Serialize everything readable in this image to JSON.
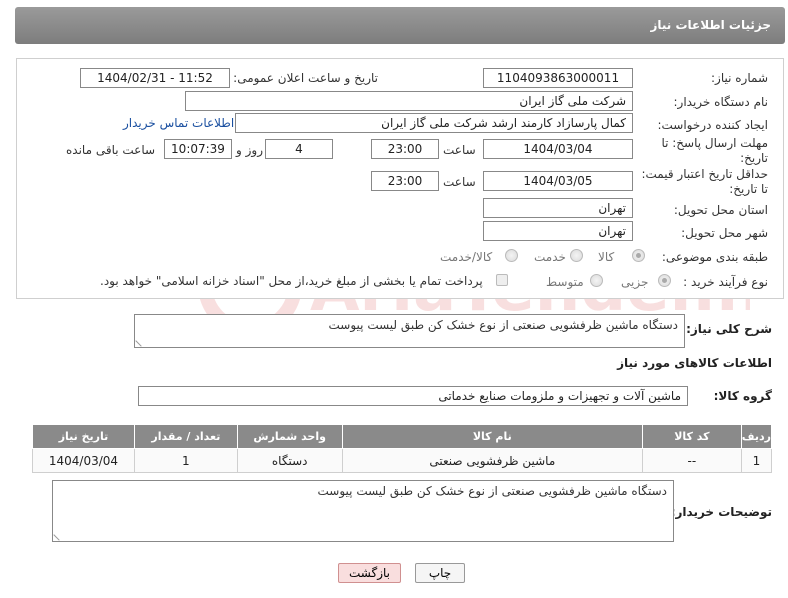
{
  "header": {
    "title": "جزئیات اطلاعات نیاز"
  },
  "form": {
    "need_number_label": "شماره نیاز:",
    "need_number": "1104093863000011",
    "announce_label": "تاریخ و ساعت اعلان عمومی:",
    "announce_value": "1404/02/31 - 11:52",
    "buyer_org_label": "نام دستگاه خریدار:",
    "buyer_org": "شرکت ملی گاز ایران",
    "creator_label": "ایجاد کننده درخواست:",
    "creator": "کمال پارسازاد کارمند ارشد شرکت ملی گاز ایران",
    "contact_link": "اطلاعات تماس خریدار",
    "reply_deadline_label_1": "مهلت ارسال پاسخ: تا",
    "reply_deadline_label_2": "تاریخ:",
    "reply_date": "1404/03/04",
    "time_label": "ساعت",
    "reply_time": "23:00",
    "days_value": "4",
    "days_label": "روز و",
    "remaining_time": "10:07:39",
    "remaining_label": "ساعت باقی مانده",
    "price_validity_label_1": "حداقل تاریخ اعتبار قیمت:",
    "price_validity_label_2": "تا تاریخ:",
    "price_date": "1404/03/05",
    "price_time": "23:00",
    "province_label": "استان محل تحویل:",
    "province": "تهران",
    "city_label": "شهر محل تحویل:",
    "city": "تهران",
    "category_label": "طبقه بندی موضوعی:",
    "category_options": [
      "کالا",
      "خدمت",
      "کالا/خدمت"
    ],
    "process_label": "نوع فرآیند خرید :",
    "process_options": [
      "جزیی",
      "متوسط"
    ],
    "payment_note": "پرداخت تمام یا بخشی از مبلغ خرید،از محل \"اسناد خزانه اسلامی\" خواهد بود."
  },
  "description": {
    "label": "شرح کلی نیاز:",
    "text": "دستگاه ماشین ظرفشویی صنعتی از نوع خشک کن طبق لیست پیوست"
  },
  "goods": {
    "section_title": "اطلاعات کالاهای مورد نیاز",
    "group_label": "گروه کالا:",
    "group_value": "ماشین آلات و تجهیزات و ملزومات صنایع خدماتی",
    "columns": [
      "ردیف",
      "کد کالا",
      "نام کالا",
      "واحد شمارش",
      "تعداد / مقدار",
      "تاریخ نیاز"
    ],
    "rows": [
      [
        "1",
        "--",
        "ماشین ظرفشویی صنعتی",
        "دستگاه",
        "1",
        "1404/03/04"
      ]
    ]
  },
  "buyer_notes": {
    "label": "توضیحات خریدار:",
    "text": "دستگاه ماشین ظرفشویی صنعتی از نوع خشک کن طبق لیست پیوست"
  },
  "buttons": {
    "print": "چاپ",
    "back": "بازگشت"
  },
  "watermark": "AriaTender.net"
}
